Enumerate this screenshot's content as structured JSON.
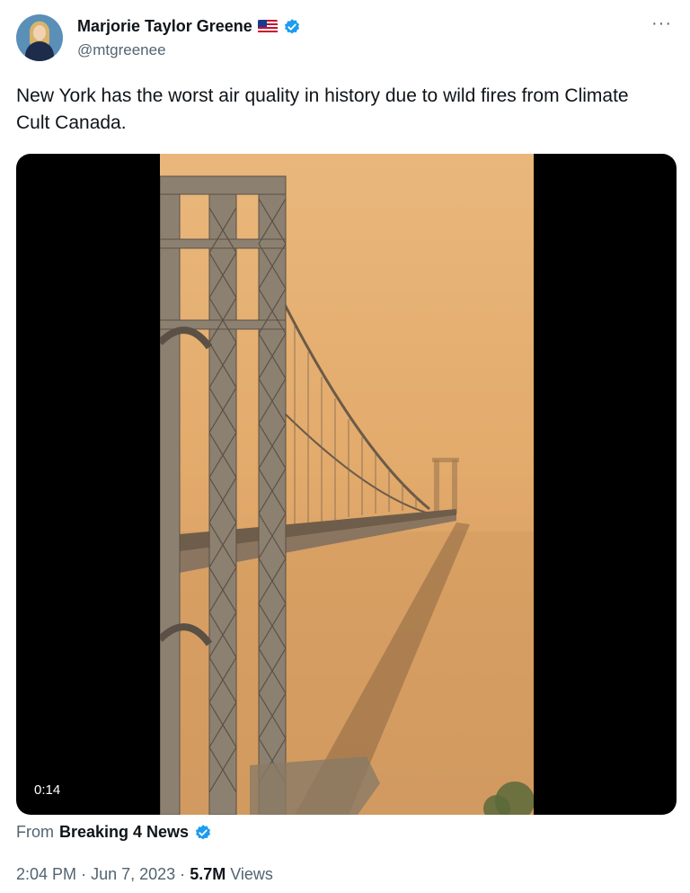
{
  "author": {
    "name": "Marjorie Taylor Greene",
    "handle": "@mtgreenee",
    "flag_icon": "us-flag-icon",
    "verified_icon": "verified-badge-icon",
    "verified_color": "#1d9bf0"
  },
  "tweet": {
    "text": "New York has the worst air quality in history due to wild fires from Climate Cult Canada."
  },
  "media": {
    "type": "video",
    "duration": "0:14"
  },
  "source": {
    "prefix": "From",
    "name": "Breaking 4 News"
  },
  "meta": {
    "time": "2:04 PM",
    "separator": "·",
    "date": "Jun 7, 2023",
    "views_count": "5.7M",
    "views_label": "Views"
  },
  "more_label": "···"
}
